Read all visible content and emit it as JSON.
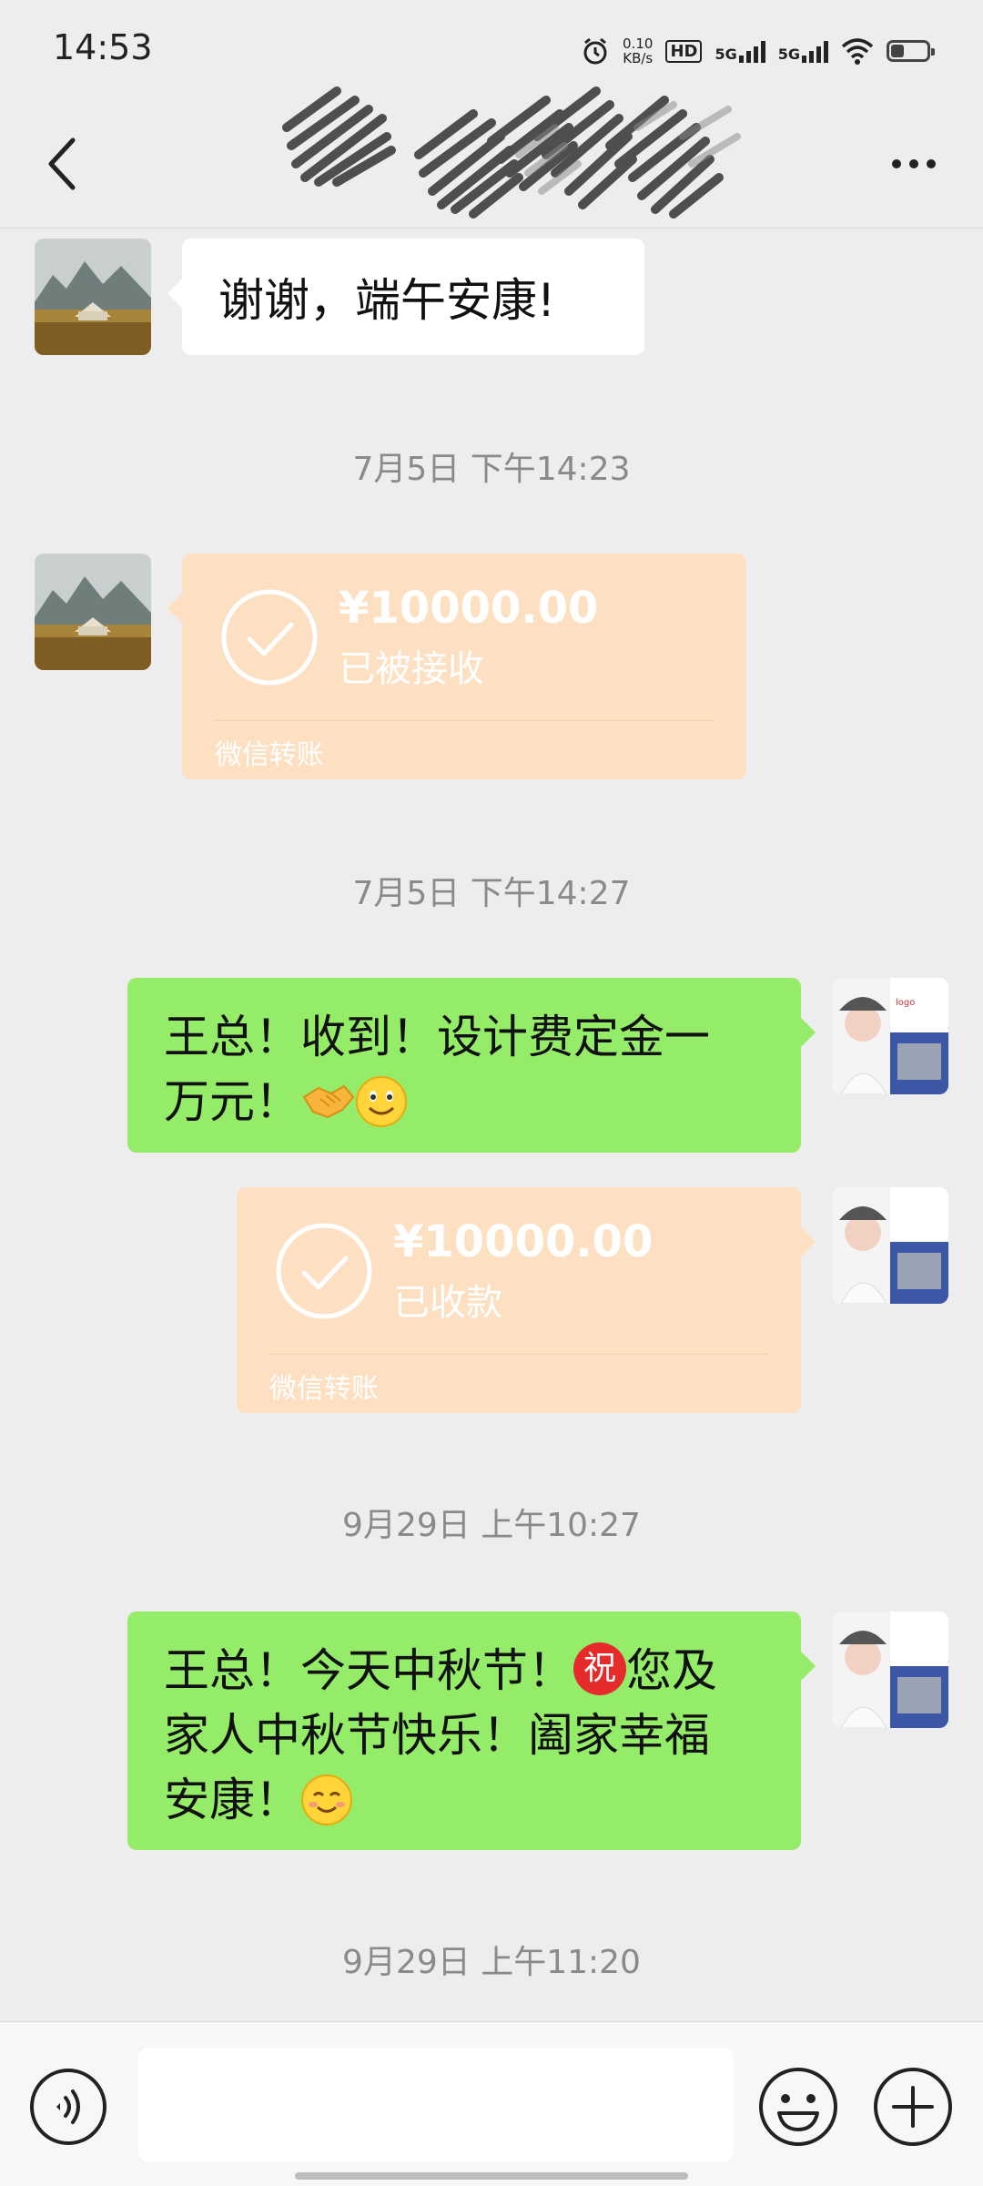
{
  "status_bar": {
    "time": "14:53",
    "net_speed_value": "0.10",
    "net_speed_unit": "KB/s",
    "hd_label": "HD",
    "signal1": "5G",
    "signal2": "5G"
  },
  "nav": {
    "back_icon": "chevron-left-icon",
    "more_icon": "more-horizontal-icon",
    "title_obscured": true
  },
  "messages": {
    "m1_text": "谢谢，端午安康!",
    "ts1": "7月5日 下午14:23",
    "transfer1": {
      "amount": "¥10000.00",
      "status": "已被接收",
      "footer": "微信转账"
    },
    "ts2": "7月5日 下午14:27",
    "m2_text_line1": "王总！收到！设计费定金一",
    "m2_text_line2": "万元！",
    "transfer2": {
      "amount": "¥10000.00",
      "status": "已收款",
      "footer": "微信转账"
    },
    "ts3": "9月29日 上午10:27",
    "m3_text_a": "王总！今天中秋节！",
    "m3_blessing": "祝",
    "m3_text_b": "您及",
    "m3_text_line2": "家人中秋节快乐！阖家幸福",
    "m3_text_line3": "安康！",
    "ts4": "9月29日 上午11:20"
  },
  "input_bar": {
    "voice_icon": "voice-icon",
    "emoji_icon": "emoji-icon",
    "plus_icon": "plus-icon",
    "placeholder": ""
  },
  "colors": {
    "background": "#ededed",
    "green_bubble": "#95ec69",
    "transfer_bubble": "#fde0c2",
    "white_bubble": "#ffffff"
  }
}
